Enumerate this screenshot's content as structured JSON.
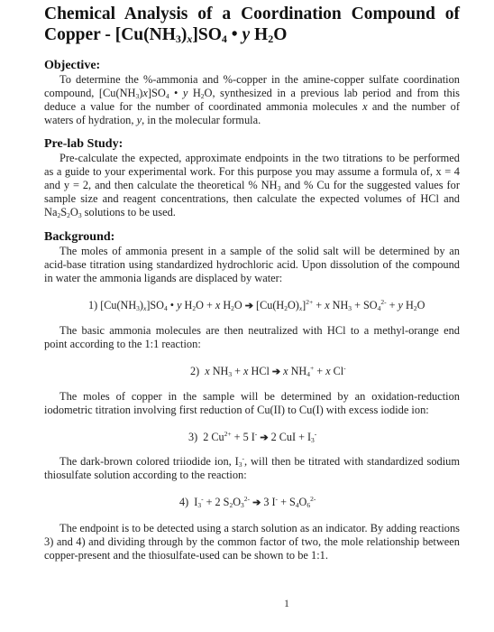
{
  "document": {
    "title_line1": "Chemical Analysis of a Coordination Compound of",
    "title_line2_prefix": "Copper - [Cu(NH",
    "page_number": "1"
  },
  "objective": {
    "heading": "Objective:",
    "text_a": "To determine the %-ammonia and %-copper in the amine-copper sulfate coordination compound, [Cu(NH",
    "text_b": "synthesized in a previous lab period and from this deduce a value for the number of coordinated ammonia molecules",
    "text_c": "and the number of waters of hydration,",
    "text_d": ", in the molecular formula."
  },
  "prelab": {
    "heading": "Pre-lab Study:",
    "text_a": "Pre-calculate the expected, approximate endpoints in the two titrations to be performed as a guide to your experimental work. For this purpose you may assume a formula of, x = 4 and y = 2, and then calculate the theoretical % NH",
    "text_b": "and % Cu for the suggested values for sample size and reagent concentrations, then calculate the expected volumes of HCl and Na",
    "text_c": "solutions to be used."
  },
  "background": {
    "heading": "Background:",
    "text_intro": "The moles of ammonia present in a sample of the solid salt will be determined by an acid-base titration using standardized hydrochloric acid. Upon dissolution of the compound in water the ammonia ligands are displaced by water:",
    "text_neutralize": "The basic ammonia molecules are then neutralized with HCl to a methyl-orange end point according to the 1:1 reaction:",
    "text_copper": "The moles of copper in the sample will be determined by an oxidation-reduction iodometric titration involving first reduction of Cu(II) to Cu(I) with excess iodide ion:",
    "text_triiodide_a": "The dark-brown colored triiodide ion, I",
    "text_triiodide_b": ", will then be titrated with standardized sodium thiosulfate solution according to the reaction:",
    "text_endpoint": "The endpoint is to be detected using a starch solution as an indicator. By adding reactions 3) and 4) and dividing through by the common factor of two, the mole relationship between copper-present and the thiosulfate-used can be shown to be 1:1."
  },
  "equations": {
    "eq1_label": "1)",
    "eq2_label": "2)",
    "eq3_label": "3)",
    "eq4_label": "4)",
    "arrow": "➔"
  }
}
